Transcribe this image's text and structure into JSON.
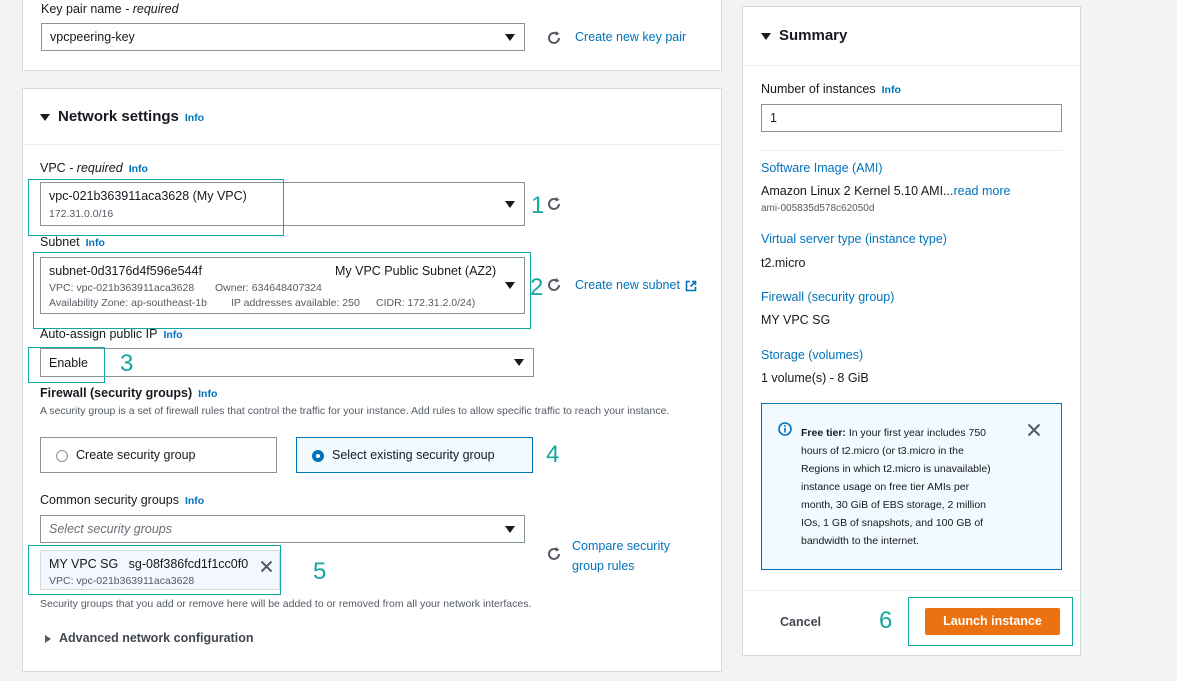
{
  "keypair": {
    "label": "Key pair name",
    "required": " - required",
    "value": "vpcpeering-key",
    "create_link": "Create new key pair"
  },
  "network": {
    "title": "Network settings",
    "info": "Info",
    "vpc": {
      "label": "VPC",
      "required": " - required",
      "info": "Info",
      "value": "vpc-021b363911aca3628 (My VPC)",
      "cidr": "172.31.0.0/16"
    },
    "subnet": {
      "label": "Subnet",
      "info": "Info",
      "id": "subnet-0d3176d4f596e544f",
      "name": "My VPC Public Subnet (AZ2)",
      "vpc": "VPC: vpc-021b363911aca3628",
      "owner": "Owner: 634648407324",
      "az": "Availability Zone: ap-southeast-1b",
      "ips": "IP addresses available: 250",
      "cidr": "CIDR: 172.31.2.0/24)",
      "create_link": "Create new subnet"
    },
    "auto_ip": {
      "label": "Auto-assign public IP",
      "info": "Info",
      "value": "Enable"
    },
    "firewall": {
      "label": "Firewall (security groups)",
      "info": "Info",
      "desc": "A security group is a set of firewall rules that control the traffic for your instance. Add rules to allow specific traffic to reach your instance.",
      "option_create": "Create security group",
      "option_existing": "Select existing security group"
    },
    "common_sg": {
      "label": "Common security groups",
      "info": "Info",
      "placeholder": "Select security groups",
      "compare_link_1": "Compare security",
      "compare_link_2": "group rules",
      "token_name": "MY VPC SG",
      "token_id": "sg-08f386fcd1f1cc0f0",
      "token_vpc": "VPC: vpc-021b363911aca3628",
      "hint": "Security groups that you add or remove here will be added to or removed from all your network interfaces."
    },
    "advanced": "Advanced network configuration"
  },
  "annotations": [
    "1",
    "2",
    "3",
    "4",
    "5",
    "6"
  ],
  "summary": {
    "title": "Summary",
    "instances_label": "Number of instances",
    "instances_info": "Info",
    "instances_value": "1",
    "ami_label": "Software Image (AMI)",
    "ami_value": "Amazon Linux 2 Kernel 5.10 AMI...",
    "ami_more": "read more",
    "ami_id": "ami-005835d578c62050d",
    "type_label": "Virtual server type (instance type)",
    "type_value": "t2.micro",
    "fw_label": "Firewall (security group)",
    "fw_value": "MY VPC SG",
    "storage_label": "Storage (volumes)",
    "storage_value": "1 volume(s) - 8 GiB",
    "free_tier_title": "Free tier:",
    "free_tier_lines": [
      " In your first year includes 750",
      "hours of t2.micro (or t3.micro in the",
      "Regions in which t2.micro is unavailable)",
      "instance usage on free tier AMIs per",
      "month, 30 GiB of EBS storage, 2 million",
      "IOs, 1 GB of snapshots, and 100 GB of",
      "bandwidth to the internet."
    ],
    "cancel": "Cancel",
    "launch": "Launch instance"
  },
  "colors": {
    "accent": "#ec7211",
    "link": "#0073bb",
    "annotation": "#13a89e"
  }
}
